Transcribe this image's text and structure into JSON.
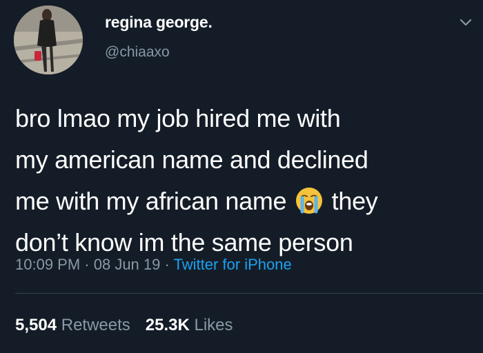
{
  "author": {
    "display_name": "regina george.",
    "handle": "@chiaaxo",
    "avatar_icon": "profile-photo"
  },
  "menu_icon": "chevron-down-icon",
  "tweet": {
    "lines": [
      "bro lmao my job hired me with",
      "my american name and declined",
      "me with my african name",
      "they",
      "don’t know im the same person"
    ],
    "emoji_icon": "loudly-crying-face-icon"
  },
  "meta": {
    "time": "10:09 PM",
    "sep1": " · ",
    "date": "08 Jun 19",
    "sep2": " · ",
    "source": "Twitter for iPhone"
  },
  "stats": {
    "retweets_count": "5,504",
    "retweets_label": "Retweets",
    "likes_count": "25.3K",
    "likes_label": "Likes"
  },
  "colors": {
    "background": "#141d27",
    "text_primary": "#ffffff",
    "text_secondary": "#8899a6",
    "link": "#1da1f2",
    "divider": "#38444d"
  }
}
